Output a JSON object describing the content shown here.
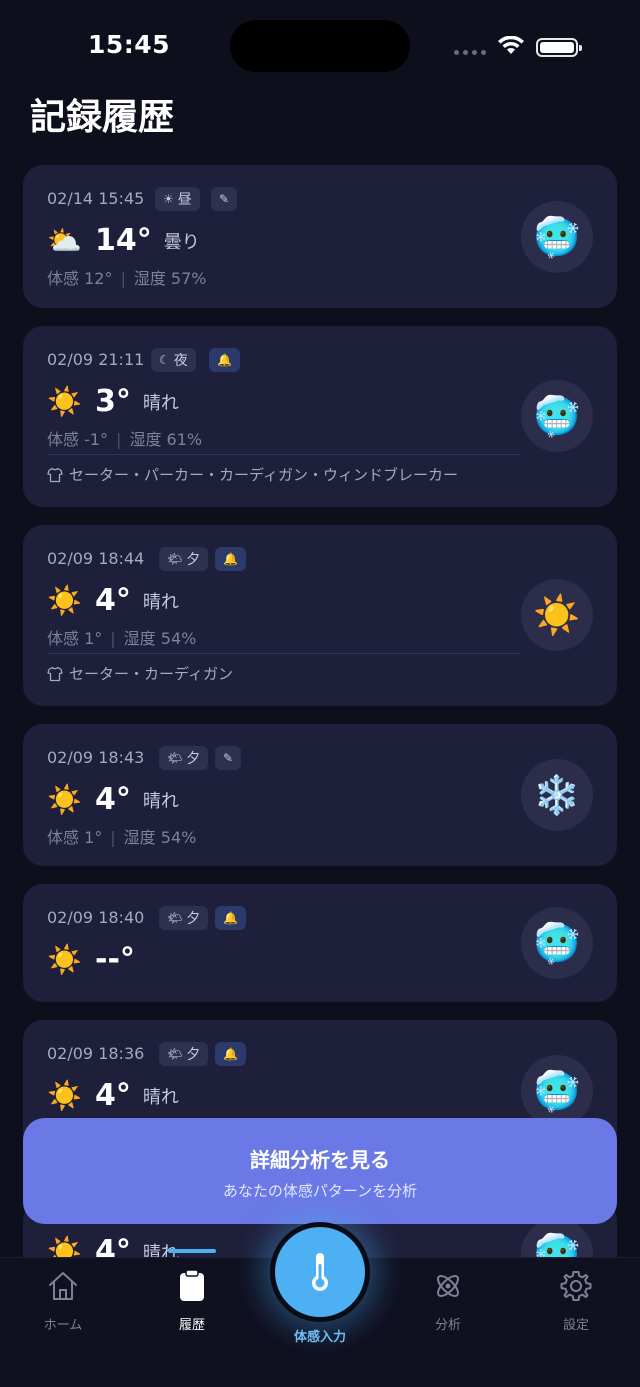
{
  "status": {
    "time": "15:45"
  },
  "page": {
    "title": "記録履歴"
  },
  "records": [
    {
      "date": "02/14 15:45",
      "badge1_icon": "☀",
      "badge1_text": "昼",
      "badge2_icon": "✎",
      "weather_icon": "⛅",
      "temp": "14°",
      "condition": "曇り",
      "feels": "体感 12°",
      "humidity": "湿度 57%",
      "clothing": "",
      "feel_emoji": "🥶"
    },
    {
      "date": "02/09 21:11",
      "badge1_icon": "☾",
      "badge1_text": "夜",
      "badge2_icon": "🔔",
      "weather_icon": "☀️",
      "temp": "3°",
      "condition": "晴れ",
      "feels": "体感 -1°",
      "humidity": "湿度 61%",
      "clothing": "セーター・パーカー・カーディガン・ウィンドブレーカー",
      "feel_emoji": "🥶"
    },
    {
      "date": "02/09 18:44",
      "badge1_icon": "🌤",
      "badge1_text": "夕",
      "badge2_icon": "🔔",
      "weather_icon": "☀️",
      "temp": "4°",
      "condition": "晴れ",
      "feels": "体感 1°",
      "humidity": "湿度 54%",
      "clothing": "セーター・カーディガン",
      "feel_emoji": "☀️"
    },
    {
      "date": "02/09 18:43",
      "badge1_icon": "🌤",
      "badge1_text": "夕",
      "badge2_icon": "✎",
      "weather_icon": "☀️",
      "temp": "4°",
      "condition": "晴れ",
      "feels": "体感 1°",
      "humidity": "湿度 54%",
      "clothing": "",
      "feel_emoji": "❄️"
    },
    {
      "date": "02/09 18:40",
      "badge1_icon": "🌤",
      "badge1_text": "夕",
      "badge2_icon": "🔔",
      "weather_icon": "☀️",
      "temp": "--°",
      "condition": "",
      "feels": "",
      "humidity": "",
      "clothing": "",
      "feel_emoji": "🥶"
    },
    {
      "date": "02/09 18:36",
      "badge1_icon": "🌤",
      "badge1_text": "夕",
      "badge2_icon": "🔔",
      "weather_icon": "☀️",
      "temp": "4°",
      "condition": "晴れ",
      "feels": "",
      "humidity": "",
      "clothing": "",
      "feel_emoji": "🥶"
    },
    {
      "date": "",
      "badge1_icon": "",
      "badge1_text": "",
      "badge2_icon": "",
      "weather_icon": "☀️",
      "temp": "4°",
      "condition": "晴れ",
      "feels": "",
      "humidity": "",
      "clothing": "",
      "feel_emoji": "🥶"
    }
  ],
  "banner": {
    "title": "詳細分析を見る",
    "subtitle": "あなたの体感パターンを分析"
  },
  "tabs": {
    "home": "ホーム",
    "history": "履歴",
    "input": "体感入力",
    "analysis": "分析",
    "settings": "設定"
  },
  "colors": {
    "background": "#0e0f1d",
    "card": "#1e1f3a",
    "accent": "#4db0f2",
    "banner": "#6a79e6"
  }
}
